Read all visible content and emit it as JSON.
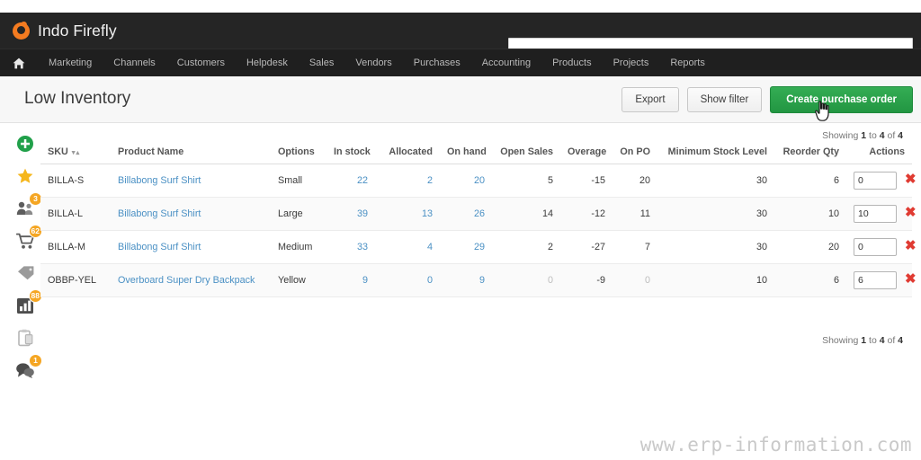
{
  "brand": {
    "name": "Indo Firefly",
    "logo_icon": "firefly-logo-icon",
    "logo_color": "#f47b20"
  },
  "search": {
    "value": "",
    "placeholder": ""
  },
  "nav": {
    "home_icon": "home-icon",
    "items": [
      {
        "label": "Marketing"
      },
      {
        "label": "Channels"
      },
      {
        "label": "Customers"
      },
      {
        "label": "Helpdesk"
      },
      {
        "label": "Sales"
      },
      {
        "label": "Vendors"
      },
      {
        "label": "Purchases"
      },
      {
        "label": "Accounting"
      },
      {
        "label": "Products"
      },
      {
        "label": "Projects"
      },
      {
        "label": "Reports"
      }
    ]
  },
  "header": {
    "title": "Low Inventory",
    "export_label": "Export",
    "show_filter_label": "Show filter",
    "create_po_label": "Create purchase order",
    "primary_color": "#2aa14a"
  },
  "rail": {
    "items": [
      {
        "icon": "add-circle-icon",
        "badge": ""
      },
      {
        "icon": "star-icon",
        "badge": ""
      },
      {
        "icon": "customers-icon",
        "badge": "3"
      },
      {
        "icon": "shopping-cart-icon",
        "badge": "62"
      },
      {
        "icon": "tag-icon",
        "badge": ""
      },
      {
        "icon": "bar-chart-icon",
        "badge": "88"
      },
      {
        "icon": "clipboard-icon",
        "badge": ""
      },
      {
        "icon": "chat-icon",
        "badge": "1"
      }
    ]
  },
  "table": {
    "showing_top": "Showing 1 to 4 of 4",
    "showing_bottom": "Showing 1 to 4 of 4",
    "sort_arrows": "▾▴",
    "columns": [
      "SKU",
      "Product Name",
      "Options",
      "In stock",
      "Allocated",
      "On hand",
      "Open Sales",
      "Overage",
      "On PO",
      "Minimum Stock Level",
      "Reorder Qty",
      "Actions"
    ],
    "rows": [
      {
        "sku": "BILLA-S",
        "product": "Billabong Surf Shirt",
        "options": "Small",
        "in_stock": "22",
        "allocated": "2",
        "on_hand": "20",
        "open_sales": "5",
        "overage": "-15",
        "on_po": "20",
        "min_stock": "30",
        "reorder_qty": "6",
        "qty_value": "0",
        "dim": false
      },
      {
        "sku": "BILLA-L",
        "product": "Billabong Surf Shirt",
        "options": "Large",
        "in_stock": "39",
        "allocated": "13",
        "on_hand": "26",
        "open_sales": "14",
        "overage": "-12",
        "on_po": "11",
        "min_stock": "30",
        "reorder_qty": "10",
        "qty_value": "10",
        "dim": false
      },
      {
        "sku": "BILLA-M",
        "product": "Billabong Surf Shirt",
        "options": "Medium",
        "in_stock": "33",
        "allocated": "4",
        "on_hand": "29",
        "open_sales": "2",
        "overage": "-27",
        "on_po": "7",
        "min_stock": "30",
        "reorder_qty": "20",
        "qty_value": "0",
        "dim": false
      },
      {
        "sku": "OBBP-YEL",
        "product": "Overboard Super Dry Backpack",
        "options": "Yellow",
        "in_stock": "9",
        "allocated": "0",
        "on_hand": "9",
        "open_sales": "0",
        "overage": "-9",
        "on_po": "0",
        "min_stock": "10",
        "reorder_qty": "6",
        "qty_value": "6",
        "dim": true
      }
    ],
    "delete_glyph": "✖"
  },
  "watermark": "www.erp-information.com"
}
